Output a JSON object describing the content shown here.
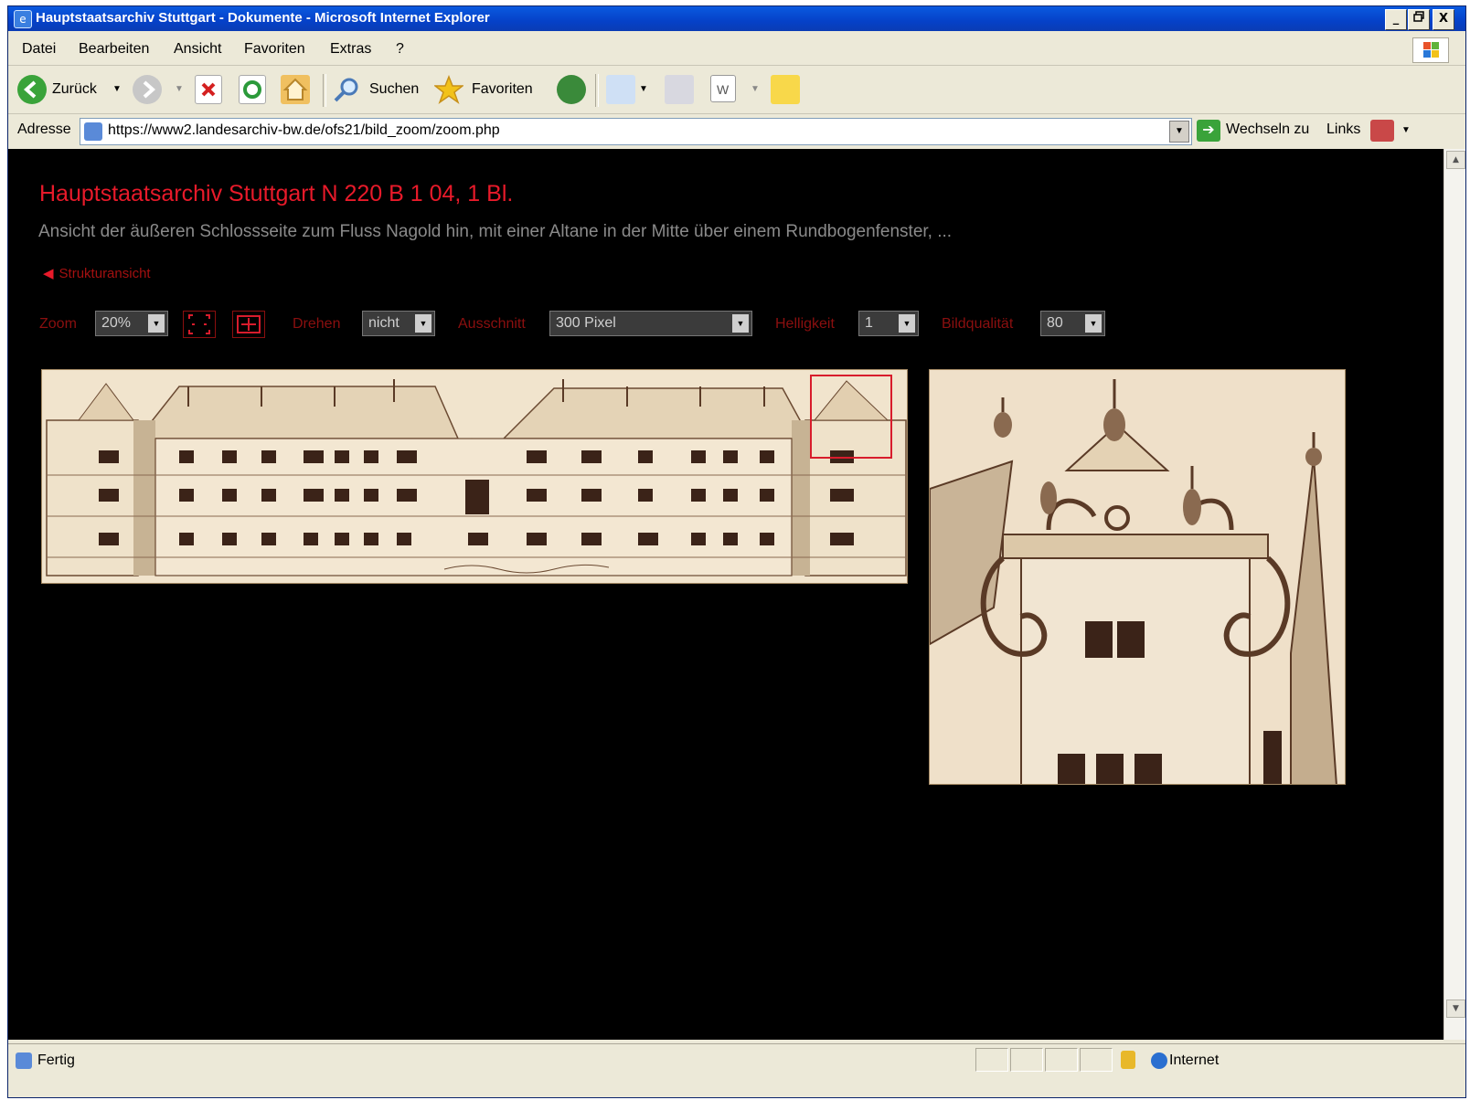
{
  "window": {
    "title": "Hauptstaatsarchiv Stuttgart - Dokumente - Microsoft Internet Explorer",
    "min": "_",
    "max": "·",
    "close": "X"
  },
  "menu": [
    "Datei",
    "Bearbeiten",
    "Ansicht",
    "Favoriten",
    "Extras",
    "?"
  ],
  "toolbar": {
    "back_label": "Zurück",
    "search_label": "Suchen",
    "favorites_label": "Favoriten"
  },
  "address": {
    "label": "Adresse",
    "url": "https://www2.landesarchiv-bw.de/ofs21/bild_zoom/zoom.php",
    "go_label": "Wechseln zu",
    "links_label": "Links"
  },
  "page": {
    "title": "Hauptstaatsarchiv Stuttgart N 220 B 1 04, 1 Bl.",
    "subtitle": "Ansicht der äußeren Schlossseite zum Fluss Nagold hin, mit einer Altane in der Mitte über einem Rundbogenfenster, ...",
    "back_link": "Strukturansicht"
  },
  "controls": {
    "zoom_label": "Zoom",
    "zoom_value": "20%",
    "rotate_label": "Drehen",
    "rotate_value": "nicht",
    "crop_label": "Ausschnitt",
    "crop_value": "300 Pixel",
    "brightness_label": "Helligkeit",
    "brightness_value": "1",
    "quality_label": "Bildqualität",
    "quality_value": "80"
  },
  "status": {
    "text": "Fertig",
    "zone": "Internet"
  },
  "icons": {
    "back": "back-arrow-icon",
    "forward": "forward-arrow-icon",
    "stop": "stop-icon",
    "refresh": "refresh-icon",
    "home": "home-icon",
    "search": "search-icon",
    "favorites": "star-icon",
    "history": "history-icon",
    "mail": "mail-icon",
    "print": "print-icon",
    "edit": "word-icon",
    "notes": "note-icon",
    "fit_window": "fit-window-icon",
    "fit_move": "move-icon",
    "lock": "lock-icon",
    "zone": "globe-icon"
  },
  "colors": {
    "title_red": "#e81a2a",
    "label_red": "#8b0f0f",
    "subtitle_gray": "#8a8a8a",
    "content_bg": "#000000"
  }
}
